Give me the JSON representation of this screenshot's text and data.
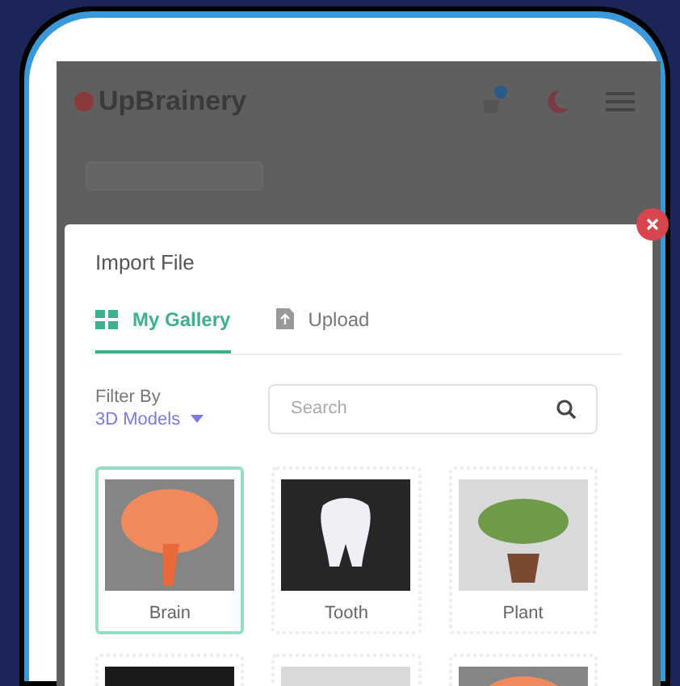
{
  "app_header": {
    "logo_text": "UpBrainery"
  },
  "dialog": {
    "title": "Import File",
    "tabs": [
      {
        "label": "My Gallery",
        "selected": true,
        "kind": "gallery"
      },
      {
        "label": "Upload",
        "selected": false,
        "kind": "upload"
      }
    ],
    "filter": {
      "label": "Filter By",
      "value": "3D Models"
    },
    "search": {
      "placeholder": "Search"
    },
    "items": [
      {
        "name": "Brain",
        "selected": true,
        "kind": "brain"
      },
      {
        "name": "Tooth",
        "selected": false,
        "kind": "tooth"
      },
      {
        "name": "Plant",
        "selected": false,
        "kind": "plant"
      },
      {
        "selected": false,
        "kind": "dark"
      },
      {
        "selected": false,
        "kind": "plant"
      },
      {
        "selected": false,
        "kind": "brain"
      }
    ]
  }
}
